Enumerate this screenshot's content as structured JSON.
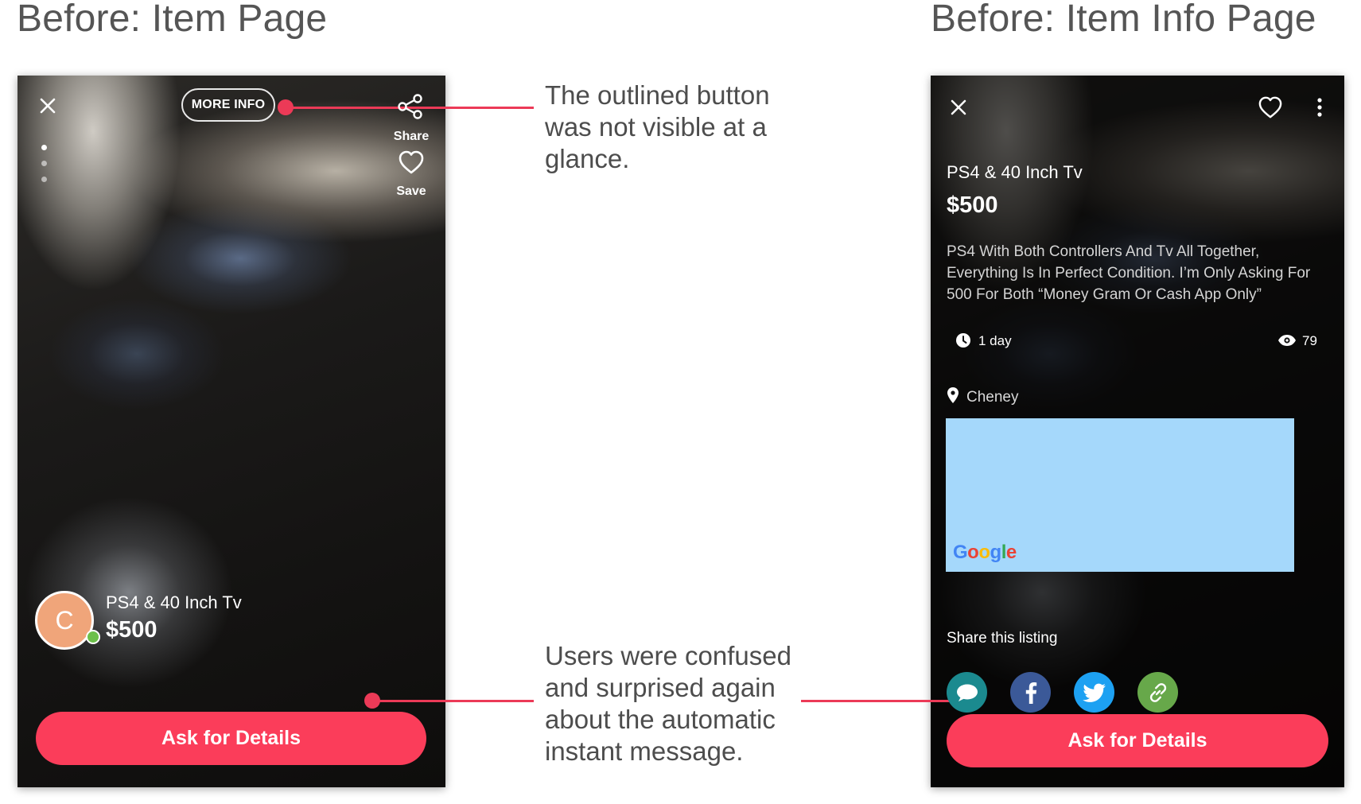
{
  "left_heading": "Before: Item Page",
  "right_heading": "Before: Item Info Page",
  "annotations": {
    "top": "The outlined button was not visible at a glance.",
    "bottom": "Users were confused and surprised again about the automatic instant message."
  },
  "item_page": {
    "more_info_label": "MORE INFO",
    "share_label": "Share",
    "save_label": "Save",
    "avatar_initial": "C",
    "title": "PS4 & 40 Inch Tv",
    "price": "$500",
    "cta_label": "Ask for Details"
  },
  "item_info_page": {
    "title": "PS4 & 40 Inch Tv",
    "price": "$500",
    "description": "PS4 With Both Controllers And Tv All Together, Everything Is In Perfect Condition. I’m Only Asking For 500 For Both “Money Gram Or Cash App Only”",
    "time_posted": "1 day",
    "view_count": "79",
    "location": "Cheney",
    "map_brand": [
      "G",
      "o",
      "o",
      "g",
      "l",
      "e"
    ],
    "share_heading": "Share this listing",
    "cta_label": "Ask for Details"
  },
  "colors": {
    "accent": "#fb3d5a",
    "annotation_line": "#ec3a57",
    "map_fill": "#a5d8fb",
    "avatar": "#f0a57a",
    "facebook": "#3b5998",
    "twitter": "#1da1f2",
    "link": "#67a84a",
    "messenger": "#1b8a8f"
  },
  "icons": [
    "close-icon",
    "share-icon",
    "heart-icon",
    "more-vert-icon",
    "clock-icon",
    "eye-icon",
    "location-pin-icon",
    "messenger-icon",
    "facebook-icon",
    "twitter-icon",
    "link-icon",
    "verified-badge-icon"
  ]
}
